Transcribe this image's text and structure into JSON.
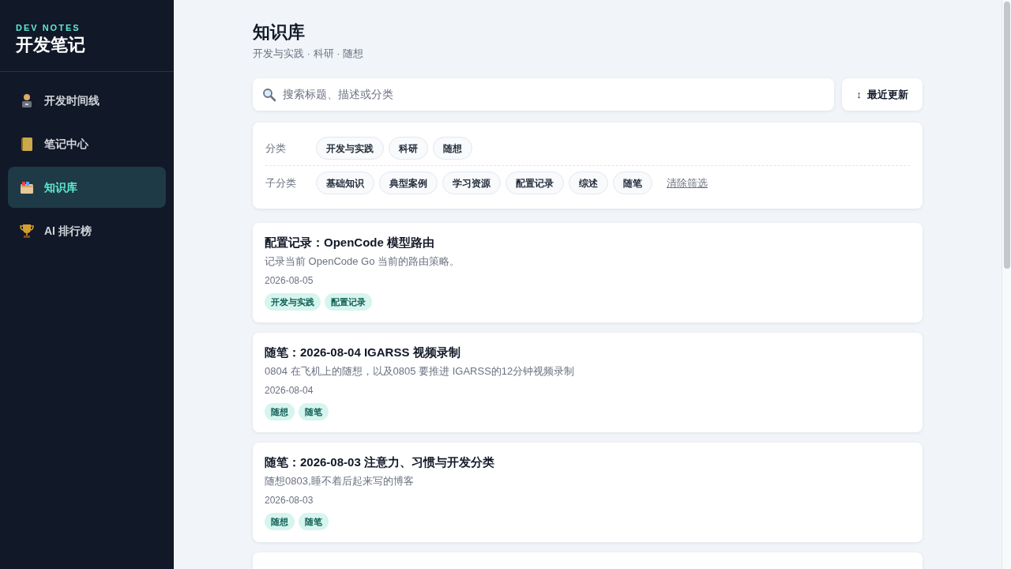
{
  "brand": {
    "eyebrow": "DEV NOTES",
    "title": "开发笔记"
  },
  "nav": [
    {
      "label": "开发时间线",
      "selected": false
    },
    {
      "label": "笔记中心",
      "selected": false
    },
    {
      "label": "知识库",
      "selected": true
    },
    {
      "label": "AI 排行榜",
      "selected": false
    }
  ],
  "header": {
    "title": "知识库",
    "subtitle": "开发与实践 · 科研 · 随想"
  },
  "search": {
    "placeholder": "搜索标题、描述或分类"
  },
  "sort_button": {
    "icon": "↕",
    "label": "最近更新"
  },
  "filters": {
    "category_label": "分类",
    "categories": [
      {
        "label": "开发与实践",
        "selected": false
      },
      {
        "label": "科研",
        "selected": false
      },
      {
        "label": "随想",
        "selected": false
      }
    ],
    "subcategory_label": "子分类",
    "subcategories": [
      {
        "label": "基础知识",
        "selected": false
      },
      {
        "label": "典型案例",
        "selected": false
      },
      {
        "label": "学习资源",
        "selected": false
      },
      {
        "label": "配置记录",
        "selected": false
      },
      {
        "label": "综述",
        "selected": false
      },
      {
        "label": "随笔",
        "selected": false
      }
    ],
    "clear_link": "清除筛选"
  },
  "articles": [
    {
      "title": "配置记录：OpenCode 模型路由",
      "description": "记录当前 OpenCode Go 当前的路由策略。",
      "date": "2026-08-05",
      "tags": [
        "开发与实践",
        "配置记录"
      ]
    },
    {
      "title": "随笔：2026-08-04 IGARSS 视频录制",
      "description": "0804 在飞机上的随想，以及0805 要推进 IGARSS的12分钟视频录制",
      "date": "2026-08-04",
      "tags": [
        "随想",
        "随笔"
      ]
    },
    {
      "title": "随笔：2026-08-03 注意力、习惯与开发分类",
      "description": "随想0803,睡不着后起来写的博客",
      "date": "2026-08-03",
      "tags": [
        "随想",
        "随笔"
      ]
    }
  ]
}
